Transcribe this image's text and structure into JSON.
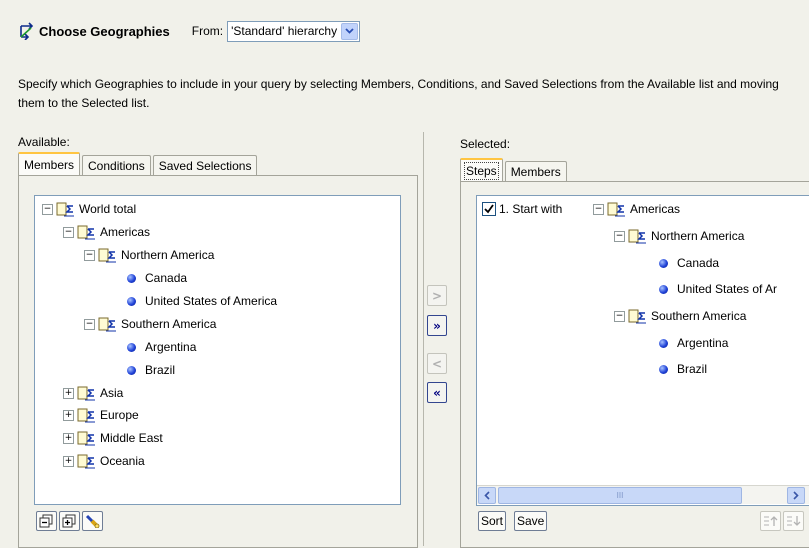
{
  "header": {
    "title": "Choose Geographies",
    "from_label": "From:",
    "hierarchy_value": "'Standard' hierarchy"
  },
  "instructions": "Specify which Geographies to include in your query by selecting Members, Conditions, and Saved Selections from the Available list and moving them to the Selected list.",
  "available": {
    "label": "Available:",
    "tabs": [
      "Members",
      "Conditions",
      "Saved Selections"
    ],
    "active_tab": "Members",
    "tree": {
      "root": "World total",
      "americas": "Americas",
      "northern_america": "Northern America",
      "canada": "Canada",
      "usa": "United States of America",
      "southern_america": "Southern America",
      "argentina": "Argentina",
      "brazil": "Brazil",
      "asia": "Asia",
      "europe": "Europe",
      "middle_east": "Middle East",
      "oceania": "Oceania"
    }
  },
  "move_buttons": {
    "add": ">",
    "add_all": "»",
    "remove": "<",
    "remove_all": "«"
  },
  "selected": {
    "label": "Selected:",
    "tabs": [
      "Steps",
      "Members"
    ],
    "active_tab": "Steps",
    "step_label": "1. Start with",
    "step_checked": true,
    "tree": {
      "americas": "Americas",
      "northern_america": "Northern America",
      "canada": "Canada",
      "usa": "United States of Ar",
      "southern_america": "Southern America",
      "argentina": "Argentina",
      "brazil": "Brazil"
    },
    "sort_label": "Sort",
    "save_label": "Save",
    "scroll_thumb_text": "III"
  },
  "colors": {
    "background": "#f1f1ea",
    "active_tab_accent": "#ffc542",
    "tree_border": "#7f9db9",
    "bullet_blue": "#2043d8"
  }
}
